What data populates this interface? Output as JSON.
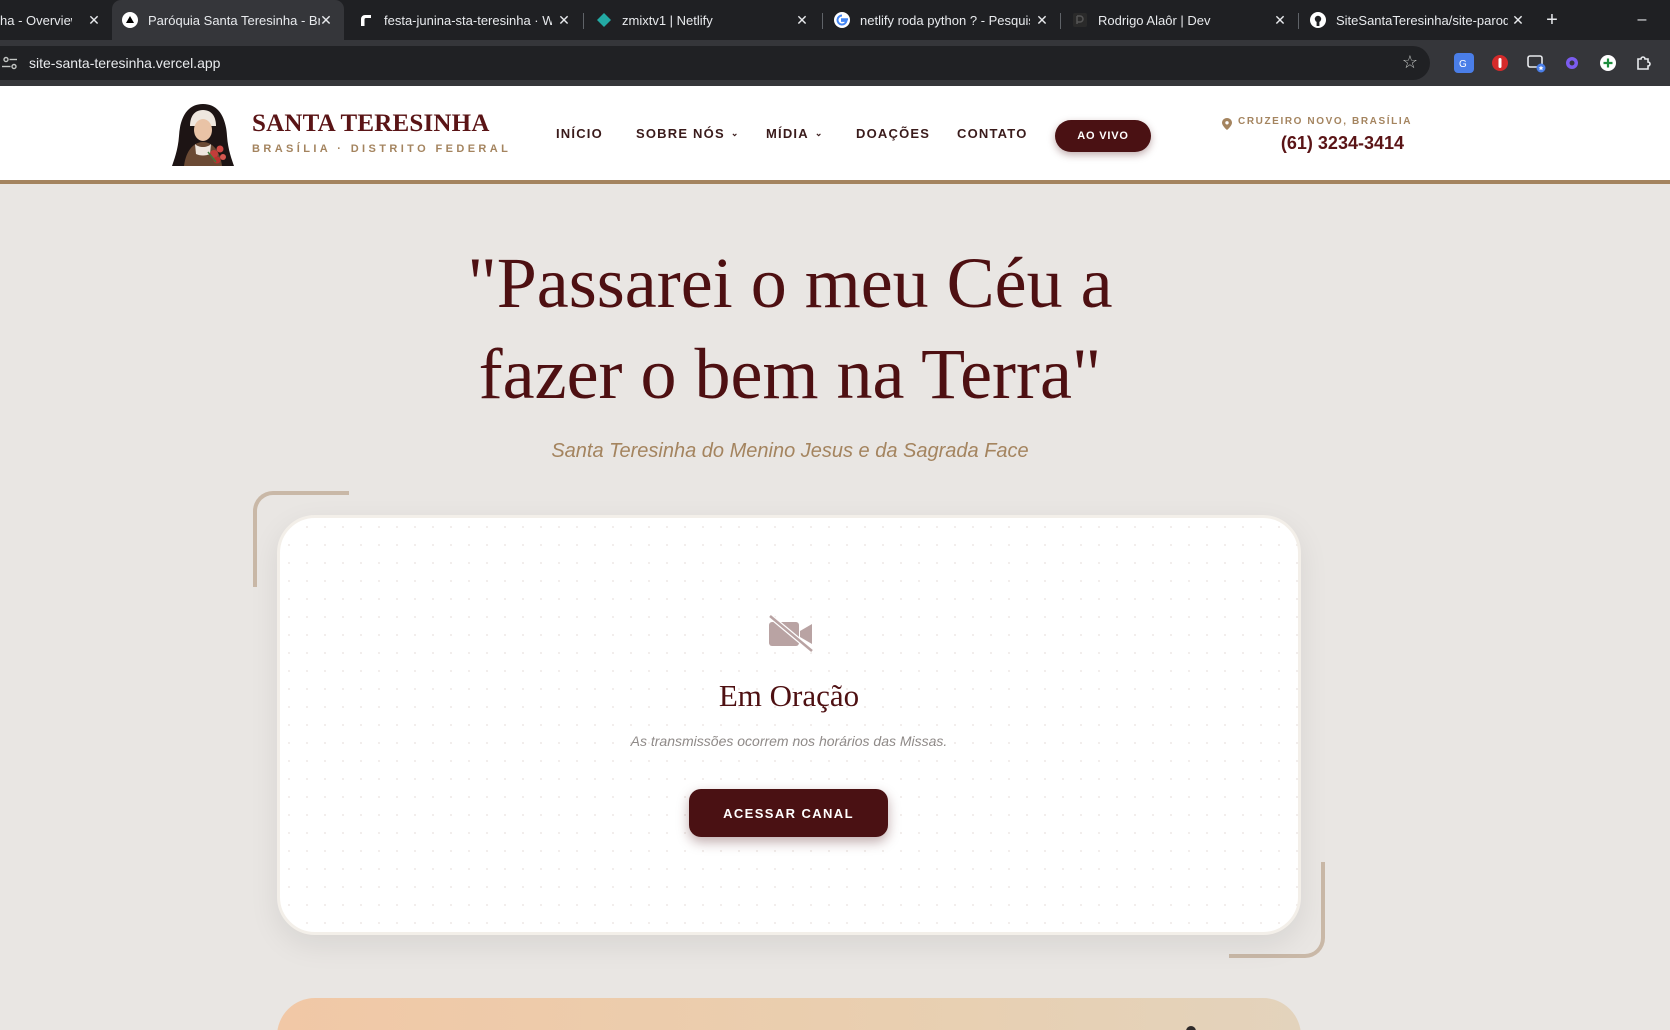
{
  "browser": {
    "tabs": [
      {
        "title": "ha - Overview",
        "icon": "vercel-icon",
        "active": false
      },
      {
        "title": "Paróquia Santa Teresinha - Bras",
        "icon": "vercel-icon",
        "active": true
      },
      {
        "title": "festa-junina-sta-teresinha · We",
        "icon": "render-icon",
        "active": false
      },
      {
        "title": "zmixtv1 | Netlify",
        "icon": "netlify-icon",
        "active": false
      },
      {
        "title": "netlify roda python ? - Pesquisa",
        "icon": "google-icon",
        "active": false
      },
      {
        "title": "Rodrigo Alaôr | Dev",
        "icon": "dev-logo-icon",
        "active": false
      },
      {
        "title": "SiteSantaTeresinha/site-paroqu",
        "icon": "github-icon",
        "active": false
      }
    ],
    "new_tab": "+",
    "minimize": "–",
    "url": "site-santa-teresinha.vercel.app"
  },
  "header": {
    "brand": "SANTA TERESINHA",
    "brand_sub": "BRASÍLIA · DISTRITO FEDERAL",
    "nav": [
      {
        "label": "INÍCIO",
        "has_dropdown": false
      },
      {
        "label": "SOBRE NÓS",
        "has_dropdown": true
      },
      {
        "label": "MÍDIA",
        "has_dropdown": true
      },
      {
        "label": "DOAÇÕES",
        "has_dropdown": false
      },
      {
        "label": "CONTATO",
        "has_dropdown": false
      }
    ],
    "live_button": "AO VIVO",
    "location": "CRUZEIRO NOVO, BRASÍLIA",
    "phone": "(61) 3234-3414"
  },
  "hero": {
    "quote_line1": "\"Passarei o meu Céu a",
    "quote_line2": "fazer o bem na Terra\"",
    "subtitle": "Santa Teresinha do Menino Jesus e da Sagrada Face"
  },
  "live_card": {
    "icon": "video-off-icon",
    "title": "Em Oração",
    "note": "As transmissões ocorrem nos horários das Missas.",
    "button": "ACESSAR CANAL"
  },
  "colors": {
    "primary": "#4a1113",
    "gold": "#a4845f",
    "background": "#e9e6e3"
  }
}
